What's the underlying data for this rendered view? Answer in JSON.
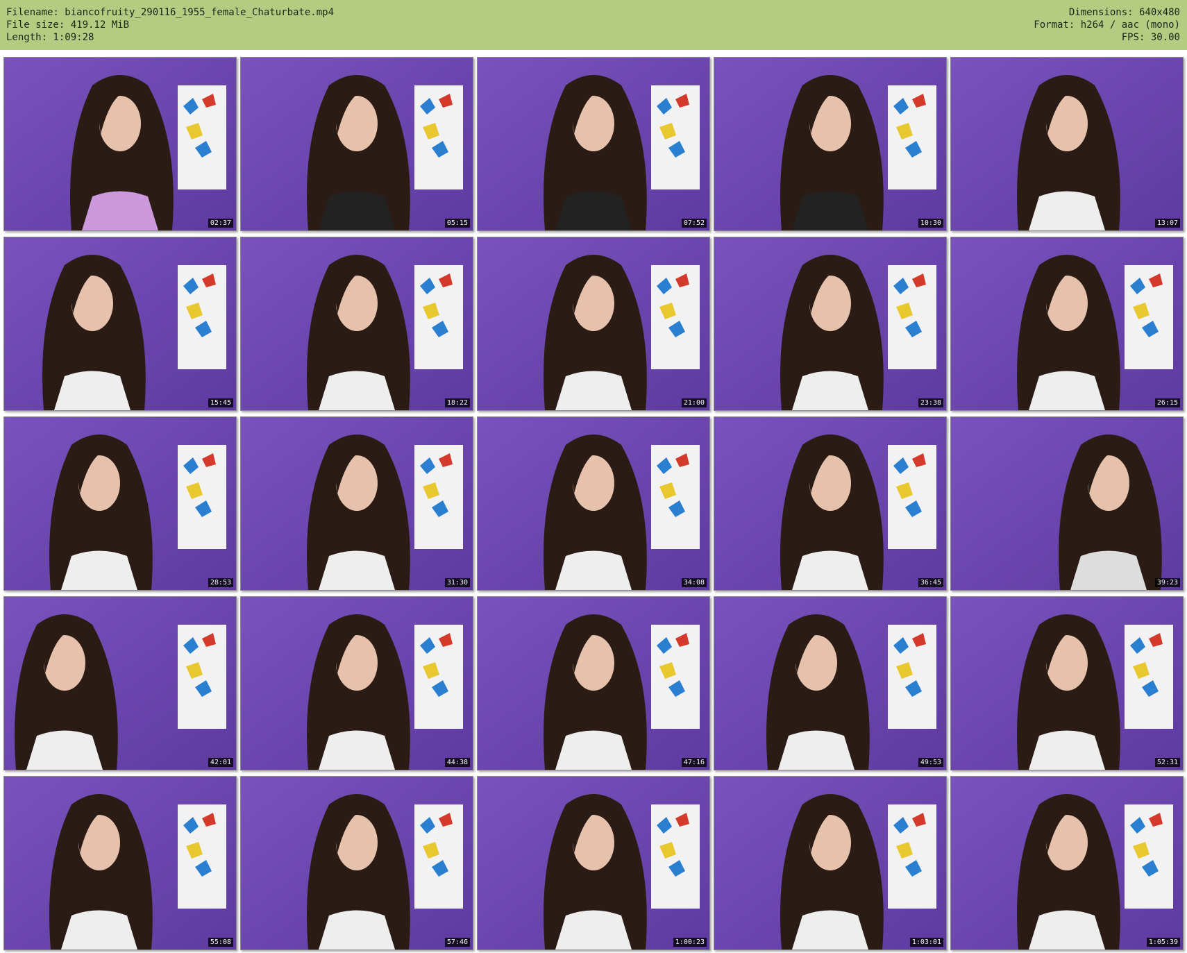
{
  "header": {
    "filename": "Filename: biancofruity_290116_1955_female_Chaturbate.mp4",
    "filesize": "File size: 419.12 MiB",
    "length": "Length: 1:09:28",
    "dimensions": "Dimensions: 640x480",
    "format": "Format: h264 / aac (mono)",
    "fps": "FPS: 30.00"
  },
  "thumbnails": [
    {
      "time": "02:37"
    },
    {
      "time": "05:15"
    },
    {
      "time": "07:52"
    },
    {
      "time": "10:30"
    },
    {
      "time": "13:07"
    },
    {
      "time": "15:45"
    },
    {
      "time": "18:22"
    },
    {
      "time": "21:00"
    },
    {
      "time": "23:38"
    },
    {
      "time": "26:15"
    },
    {
      "time": "28:53"
    },
    {
      "time": "31:30"
    },
    {
      "time": "34:08"
    },
    {
      "time": "36:45"
    },
    {
      "time": "39:23"
    },
    {
      "time": "42:01"
    },
    {
      "time": "44:38"
    },
    {
      "time": "47:16"
    },
    {
      "time": "49:53"
    },
    {
      "time": "52:31"
    },
    {
      "time": "55:08"
    },
    {
      "time": "57:46"
    },
    {
      "time": "1:00:23"
    },
    {
      "time": "1:03:01"
    },
    {
      "time": "1:05:39"
    }
  ],
  "colors": {
    "header_bg": "#b3cc82",
    "wall": "#6e49b0",
    "hair": "#2a1c14",
    "skin": "#e6c2ad",
    "poster": "#f2f2f2",
    "butterfly_blue": "#2a7fd0",
    "butterfly_red": "#d43a2c",
    "butterfly_yellow": "#e8c82e"
  }
}
